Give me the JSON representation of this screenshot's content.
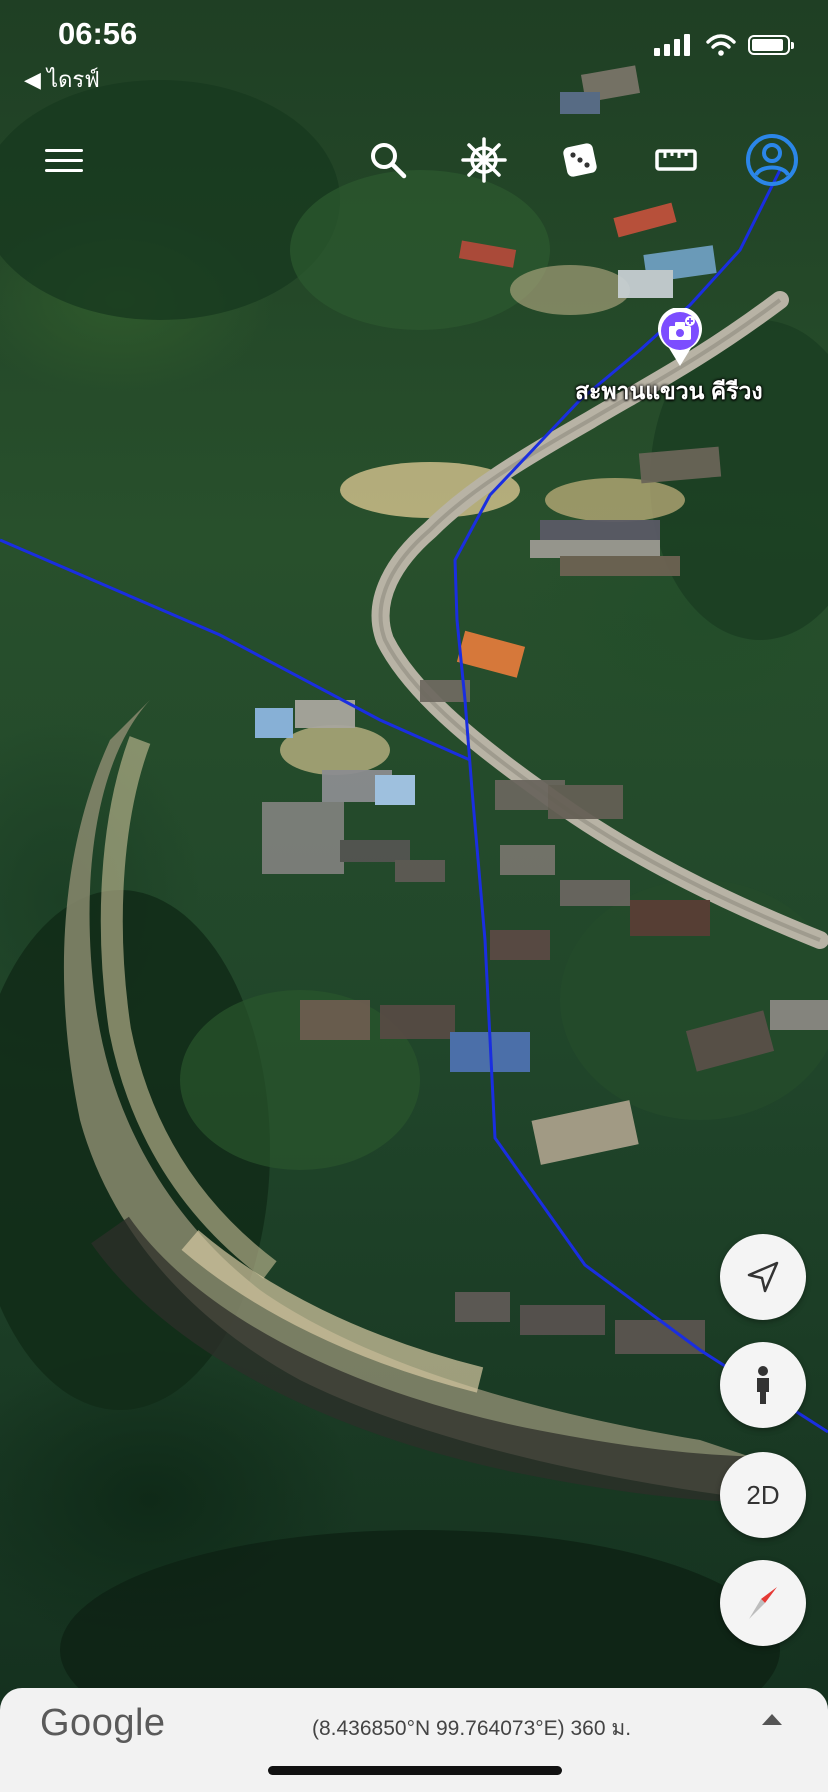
{
  "status_bar": {
    "time": "06:56",
    "back_label": "◀ ไดรฟ์",
    "battery_level": 0.9
  },
  "toolbar": {
    "icons": [
      "menu-icon",
      "search-icon",
      "voyager-wheel-icon",
      "dice-icon",
      "ruler-icon",
      "account-icon"
    ]
  },
  "map": {
    "place_label": "สะพานแขวน คีรีวง",
    "place_icon": "camera-add-icon",
    "route_color": "#1a2ee0"
  },
  "controls": {
    "locate_icon": "locate-arrow-icon",
    "street_view_icon": "pegman-icon",
    "view_toggle_label": "2D",
    "compass_icon": "compass-icon"
  },
  "bottom_bar": {
    "logo": "Google",
    "coordinates": "(8.436850°N 99.764073°E) 360 ม."
  }
}
